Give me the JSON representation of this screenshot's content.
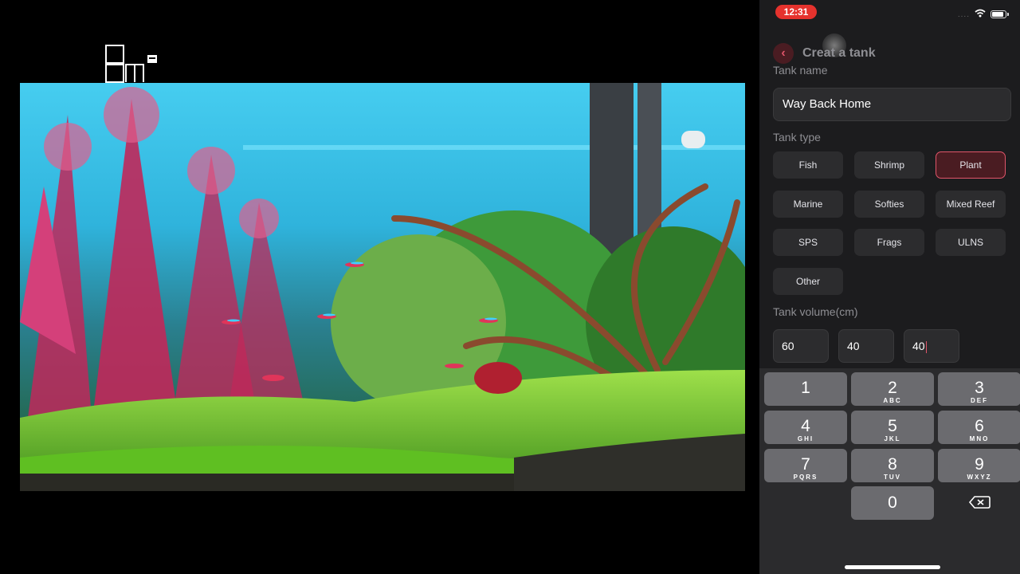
{
  "status_bar": {
    "time": "12:31",
    "signal_dots": "....",
    "battery_icon": "battery-icon",
    "wifi_icon": "wifi-icon"
  },
  "header": {
    "title": "Creat a tank",
    "back_icon": "chevron-left-icon"
  },
  "form": {
    "name_label": "Tank name",
    "name_value": "Way Back Home",
    "type_label": "Tank type",
    "tank_types": [
      "Fish",
      "Shrimp",
      "Plant",
      "Marine",
      "Softies",
      "Mixed Reef",
      "SPS",
      "Frags",
      "ULNS",
      "Other"
    ],
    "selected_type": "Plant",
    "volume_label": "Tank volume(cm)",
    "volume_values": [
      "60",
      "40",
      "40"
    ]
  },
  "keypad": {
    "keys": [
      {
        "digit": "1",
        "letters": ""
      },
      {
        "digit": "2",
        "letters": "ABC"
      },
      {
        "digit": "3",
        "letters": "DEF"
      },
      {
        "digit": "4",
        "letters": "GHI"
      },
      {
        "digit": "5",
        "letters": "JKL"
      },
      {
        "digit": "6",
        "letters": "MNO"
      },
      {
        "digit": "7",
        "letters": "PQRS"
      },
      {
        "digit": "8",
        "letters": "TUV"
      },
      {
        "digit": "9",
        "letters": "WXYZ"
      }
    ],
    "zero": "0",
    "delete_icon": "backspace-icon"
  },
  "colors": {
    "accent": "#e0556a",
    "status_red": "#e5322d",
    "panel_bg": "#1c1c1e",
    "button_bg": "#2c2c2e"
  }
}
